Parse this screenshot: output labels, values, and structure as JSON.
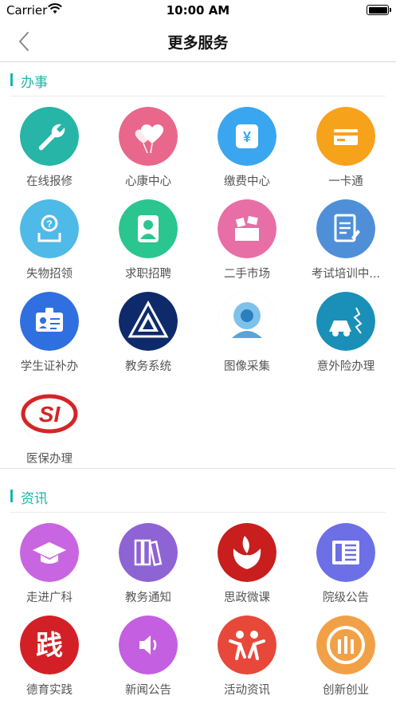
{
  "status_bar": {
    "carrier": "Carrier",
    "time": "10:00 AM"
  },
  "nav": {
    "title": "更多服务"
  },
  "sections": [
    {
      "title": "办事",
      "items": [
        {
          "label": "在线报修",
          "icon": "wrench-icon",
          "color": "#26b5a6"
        },
        {
          "label": "心康中心",
          "icon": "heart-balloons-icon",
          "color": "#e8678b"
        },
        {
          "label": "缴费中心",
          "icon": "yuan-payment-icon",
          "color": "#3aa6ef"
        },
        {
          "label": "一卡通",
          "icon": "card-icon",
          "color": "#f7a21b"
        },
        {
          "label": "失物招领",
          "icon": "lost-found-icon",
          "color": "#4fb9e8"
        },
        {
          "label": "求职招聘",
          "icon": "job-person-icon",
          "color": "#2bc58f"
        },
        {
          "label": "二手市场",
          "icon": "secondhand-market-icon",
          "color": "#e86ea6"
        },
        {
          "label": "考试培训中...",
          "icon": "exam-clipboard-icon",
          "color": "#4f8fd8"
        },
        {
          "label": "学生证补办",
          "icon": "student-id-card-icon",
          "color": "#2f6fe0"
        },
        {
          "label": "教务系统",
          "icon": "academic-system-logo-icon",
          "color": "#0f2a6b"
        },
        {
          "label": "图像采集",
          "icon": "webcam-icon",
          "color": "#5aa3d8"
        },
        {
          "label": "意外险办理",
          "icon": "accident-insurance-icon",
          "color": "#1a8fb8"
        },
        {
          "label": "医保办理",
          "icon": "si-medical-insurance-logo-icon",
          "color": "#d42525"
        }
      ]
    },
    {
      "title": "资讯",
      "items": [
        {
          "label": "走进广科",
          "icon": "graduation-cap-icon",
          "color": "#c865e0"
        },
        {
          "label": "教务通知",
          "icon": "books-icon",
          "color": "#8e63d4"
        },
        {
          "label": "思政微课",
          "icon": "ideology-course-logo-icon",
          "color": "#c81e1e"
        },
        {
          "label": "院级公告",
          "icon": "newspaper-icon",
          "color": "#6c6fe6"
        },
        {
          "label": "德育实践",
          "icon": "practice-character-icon",
          "color": "#d32026"
        },
        {
          "label": "新闻公告",
          "icon": "speaker-icon",
          "color": "#c35fe0"
        },
        {
          "label": "活动资讯",
          "icon": "people-activity-icon",
          "color": "#e8483a"
        },
        {
          "label": "创新创业",
          "icon": "innovation-logo-icon",
          "color": "#f2a046"
        }
      ]
    }
  ]
}
